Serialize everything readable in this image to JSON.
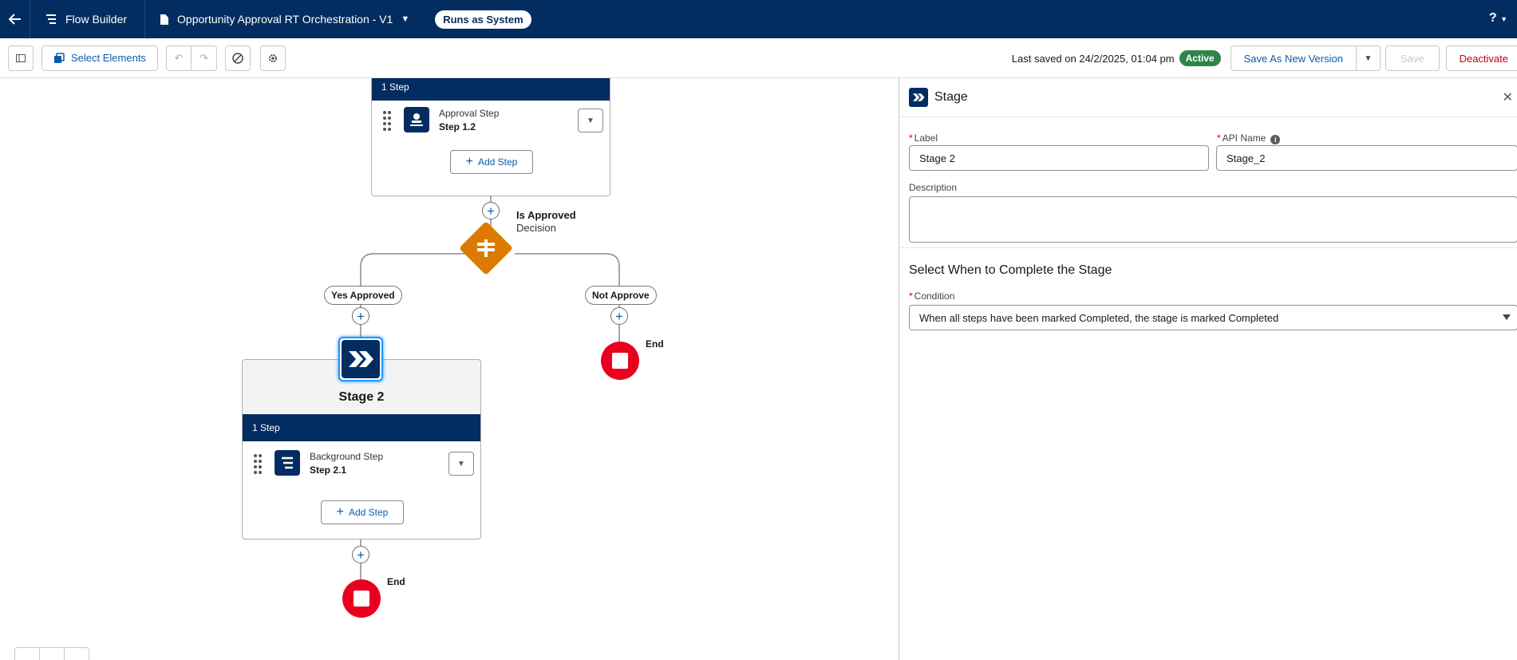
{
  "header": {
    "app_name": "Flow Builder",
    "flow_name": "Opportunity Approval RT Orchestration - V1",
    "runs_as": "Runs as System",
    "help_icon": "?"
  },
  "toolbar": {
    "select_elements_label": "Select Elements",
    "last_saved": "Last saved on 24/2/2025, 01:04 pm",
    "status_badge": "Active",
    "save_as_new_version_label": "Save As New Version",
    "save_label": "Save",
    "deactivate_label": "Deactivate"
  },
  "canvas": {
    "stage1": {
      "step_count": "1 Step",
      "step": {
        "type": "Approval Step",
        "name": "Step 1.2"
      },
      "add_step_label": "Add Step"
    },
    "decision": {
      "title": "Is Approved",
      "type": "Decision"
    },
    "branches": {
      "yes": "Yes Approved",
      "no": "Not Approve"
    },
    "stage2": {
      "title": "Stage 2",
      "step_count": "1 Step",
      "step": {
        "type": "Background Step",
        "name": "Step 2.1"
      },
      "add_step_label": "Add Step"
    },
    "end_label_right": "End",
    "end_label_bottom": "End"
  },
  "panel": {
    "title": "Stage",
    "label_field": {
      "label": "Label",
      "value": "Stage 2"
    },
    "api_name_field": {
      "label": "API Name",
      "value": "Stage_2"
    },
    "description_field": {
      "label": "Description",
      "value": ""
    },
    "section_title": "Select When to Complete the Stage",
    "condition_field": {
      "label": "Condition",
      "value": "When all steps have been marked Completed, the stage is marked Completed"
    }
  },
  "colors": {
    "brand_navy": "#032d60",
    "active_green": "#2e844a",
    "decision_orange": "#dd7a01",
    "end_red": "#ea001e",
    "link_blue": "#0b5cab"
  }
}
